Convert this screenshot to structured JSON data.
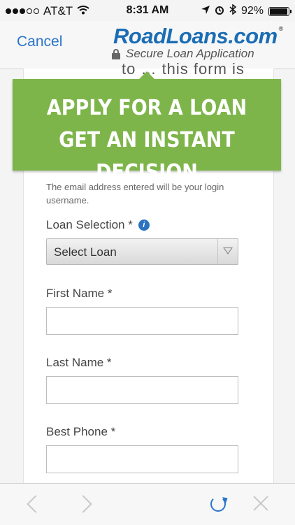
{
  "status_bar": {
    "carrier": "AT&T",
    "time": "8:31 AM",
    "battery": "92%",
    "battery_level": 0.92
  },
  "header": {
    "cancel_label": "Cancel",
    "brand": "RoadLoans.com",
    "brand_reg": "®",
    "subtitle": "Secure Loan Application"
  },
  "form": {
    "clipped_text": "to … this form is",
    "promo_line1": "APPLY FOR A LOAN",
    "promo_line2": "GET AN INSTANT DECISION",
    "email_helper": "The email address entered will be your login username.",
    "loan_selection_label": "Loan Selection *",
    "loan_select_value": "Select Loan",
    "first_name_label": "First Name *",
    "last_name_label": "Last Name *",
    "best_phone_label": "Best Phone *"
  },
  "icons": {
    "info": "i",
    "accent_color": "#2a74c9",
    "banner_color": "#7eb54a"
  }
}
